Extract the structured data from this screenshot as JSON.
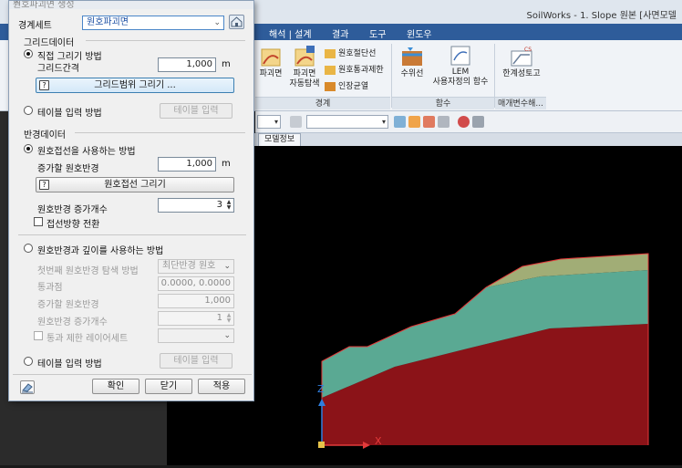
{
  "app": {
    "title": "SoilWorks - 1. Slope 원본 [사면모델",
    "ribbon_tabs": [
      "해석 | 설계",
      "결과",
      "도구",
      "윈도우"
    ],
    "groups": {
      "boundary_label": "경계",
      "function_label": "함수",
      "limit_label": "매개변수해..."
    },
    "buttons": {
      "slip_surface": "파괴면",
      "slip_auto_line1": "파괴면",
      "slip_auto_line2": "자동탐색",
      "arc_cut_line": "원호절단선",
      "arc_pass_limit": "원호통과제한",
      "tension_crack": "인장균열",
      "water_level": "수위선",
      "lem_line1": "LEM",
      "lem_line2": "사용자정의 함수",
      "limit_design": "한계성토고"
    },
    "doc_tab": "모델정보"
  },
  "dialog": {
    "title": "원호파괴면 생성",
    "close": "×",
    "boundary_set_label": "경계세트",
    "boundary_set_value": "원호파괴면",
    "grid_section": "그리드데이터",
    "grid_direct": "직접 그리기 방법",
    "grid_spacing_label": "그리드간격",
    "grid_spacing_value": "1,000",
    "grid_spacing_unit": "m",
    "grid_draw_button": "그리드범위 그리기 ...",
    "table_input_1": "테이블 입력 방법",
    "table_input_btn_1": "테이블 입력",
    "radius_section": "반경데이터",
    "use_tangent": "원호접선을 사용하는 방법",
    "radius_increment_label": "증가할 원호반경",
    "radius_increment_value": "1,000",
    "radius_increment_unit": "m",
    "tangent_draw_button": "원호접선 그리기",
    "radius_count_label": "원호반경 증가개수",
    "radius_count_value": "3",
    "tangent_direction": "접선방향 전환",
    "use_radius_depth": "원호반경과 깊이를 사용하는 방법",
    "first_radius_label": "첫번째 원호반경 탐색 방법",
    "first_radius_value": "최단반경 원호",
    "pass_point_label": "통과점",
    "pass_point_value": "0.0000, 0.0000",
    "radius_inc2_label": "증가할 원호반경",
    "radius_inc2_value": "1,000",
    "radius_count2_label": "원호반경 증가개수",
    "radius_count2_value": "1",
    "pass_layer_label": "통과 제한 레이어세트",
    "table_input_2": "테이블 입력 방법",
    "table_input_btn_2": "테이블 입력",
    "confirm": "확인",
    "close_btn": "닫기",
    "apply": "적용"
  },
  "canvas": {
    "axis_x": "X",
    "axis_z": "Z",
    "colors": {
      "bottom": "#8b1318",
      "middle": "#5aa993",
      "top": "#a1ad76",
      "outline": "#e33a3a"
    }
  }
}
